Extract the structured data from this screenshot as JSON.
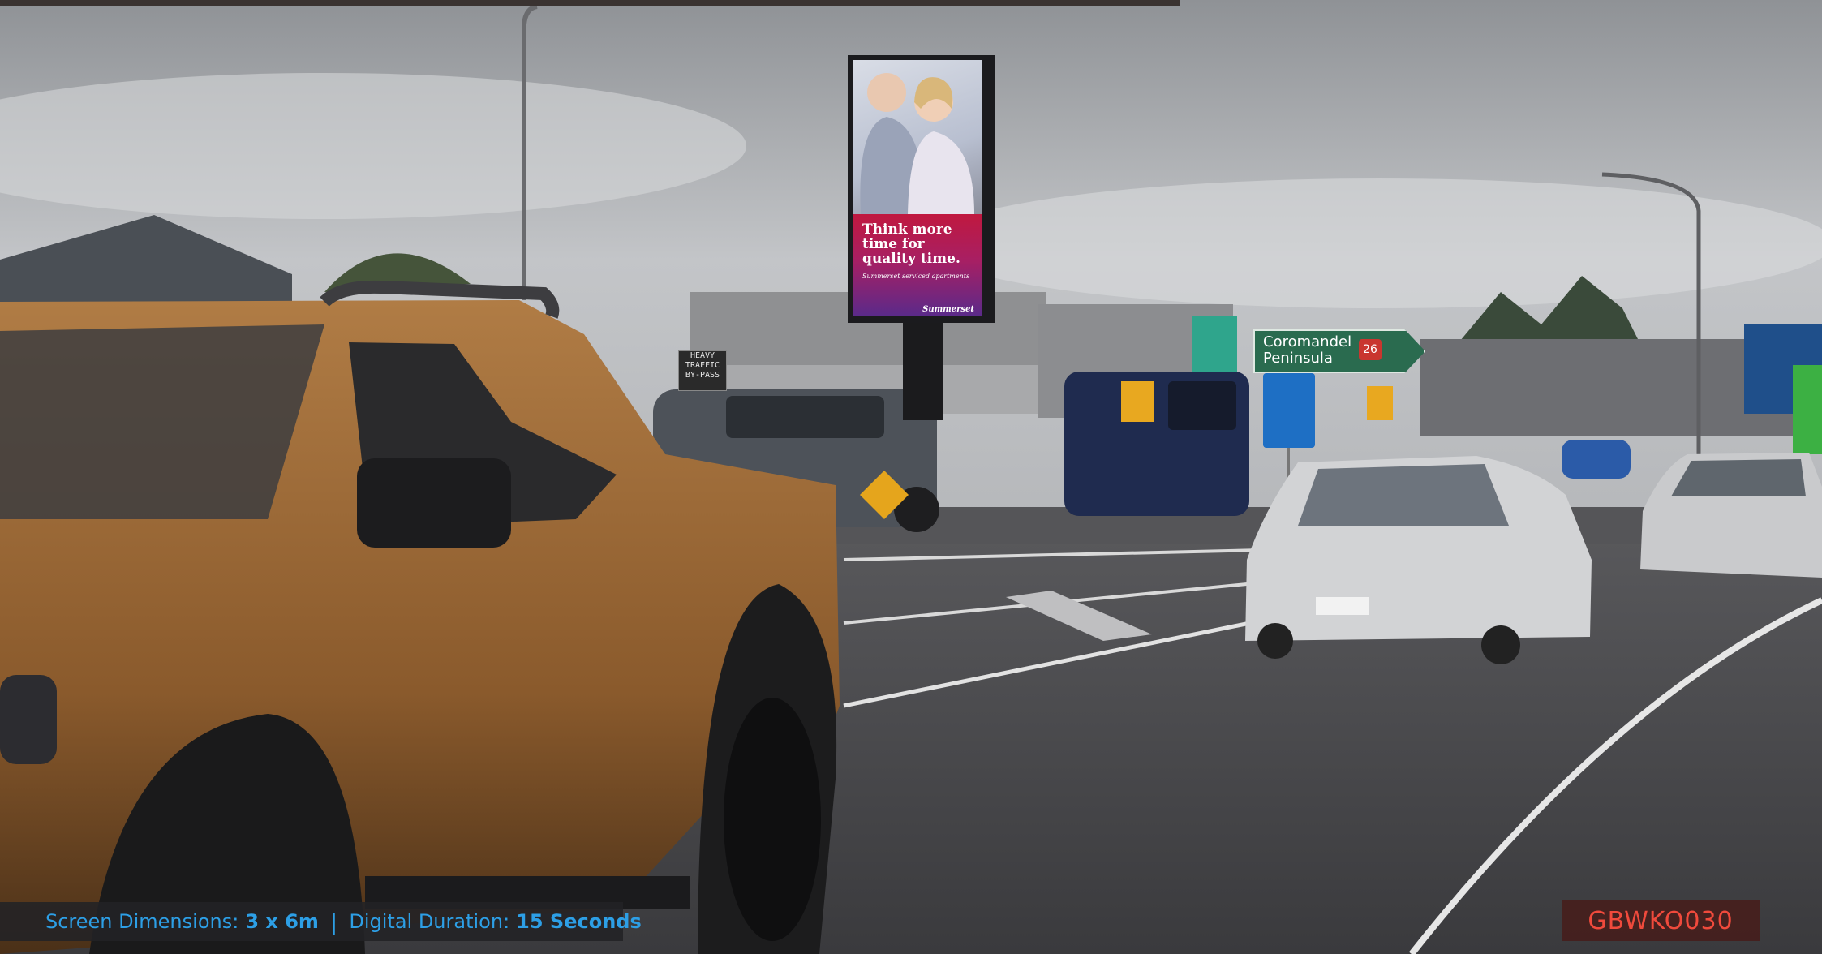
{
  "caption": {
    "dimensions_label": "Screen Dimensions:",
    "dimensions_value": "3 x 6m",
    "separator": "|",
    "duration_label": "Digital Duration:",
    "duration_value": "15 Seconds"
  },
  "site_code": "GBWKO030",
  "billboard_ad": {
    "headline": "Think more time for quality time.",
    "subline": "Summerset serviced apartments",
    "brand": "Summerset"
  },
  "road_sign": {
    "line1": "Coromandel",
    "line2": "Peninsula",
    "route": "26"
  },
  "heavy_traffic_sign": {
    "line1": "HEAVY",
    "line2": "TRAFFIC",
    "line3": "BY-PASS"
  },
  "colors": {
    "caption_text": "#2d9fe6",
    "site_code_text": "#f04a3c",
    "ad_panel": "#c0183f"
  }
}
